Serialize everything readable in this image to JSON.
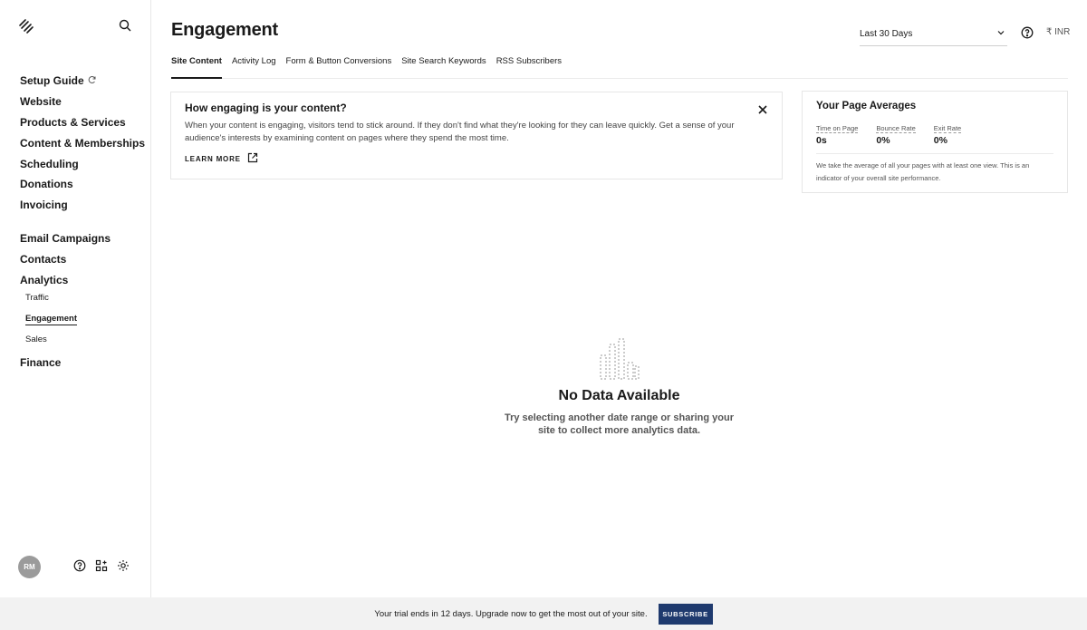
{
  "sidebar": {
    "logo_icon": "squarespace-logo-icon",
    "search_icon": "search-icon",
    "items": [
      {
        "label": "Setup Guide",
        "icon": "refresh-icon"
      },
      {
        "label": "Website"
      },
      {
        "label": "Products & Services"
      },
      {
        "label": "Content & Memberships"
      },
      {
        "label": "Scheduling"
      },
      {
        "label": "Donations"
      },
      {
        "label": "Invoicing"
      },
      {
        "label": "Email Campaigns"
      },
      {
        "label": "Contacts"
      },
      {
        "label": "Analytics"
      },
      {
        "label": "Finance"
      }
    ],
    "analytics_sub": [
      {
        "label": "Traffic"
      },
      {
        "label": "Engagement",
        "active": true
      },
      {
        "label": "Sales"
      }
    ],
    "avatar_initials": "RM",
    "bottom_icons": [
      "help-icon",
      "apps-icon",
      "settings-icon"
    ]
  },
  "header": {
    "title": "Engagement",
    "date_range": "Last 30 Days",
    "currency": "₹ INR"
  },
  "tabs": [
    {
      "label": "Site Content",
      "active": true
    },
    {
      "label": "Activity Log"
    },
    {
      "label": "Form & Button Conversions"
    },
    {
      "label": "Site Search Keywords"
    },
    {
      "label": "RSS Subscribers"
    }
  ],
  "info_card": {
    "title": "How engaging is your content?",
    "text": "When your content is engaging, visitors tend to stick around. If they don't find what they're looking for they can leave quickly. Get a sense of your audience's interests by examining content on pages where they spend the most time.",
    "learn_more": "LEARN MORE"
  },
  "averages": {
    "title": "Your Page Averages",
    "metrics": [
      {
        "label": "Time on Page",
        "value": "0s"
      },
      {
        "label": "Bounce Rate",
        "value": "0%"
      },
      {
        "label": "Exit Rate",
        "value": "0%"
      }
    ],
    "note": "We take the average of all your pages with at least one view. This is an indicator of your overall site performance."
  },
  "empty_state": {
    "title": "No Data Available",
    "text": "Try selecting another date range or sharing your site to collect more analytics data."
  },
  "trial_bar": {
    "text": "Your trial ends in 12 days. Upgrade now to get the most out of your site.",
    "button": "SUBSCRIBE"
  },
  "colors": {
    "accent": "#1f3a6e",
    "trial_bg": "#f2f2f2"
  }
}
